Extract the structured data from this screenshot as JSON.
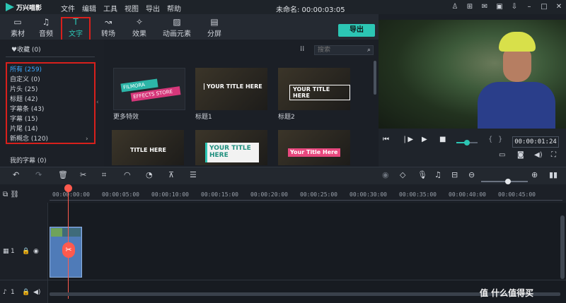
{
  "app": {
    "logo_text": "万兴喵影",
    "window_title": "未命名: 00:00:03:05",
    "menus": [
      "文件",
      "编辑",
      "工具",
      "视图",
      "导出",
      "帮助"
    ]
  },
  "tabs": [
    {
      "label": "素材",
      "icon": "folder-icon"
    },
    {
      "label": "音频",
      "icon": "music-note-icon"
    },
    {
      "label": "文字",
      "icon": "text-icon",
      "active": true
    },
    {
      "label": "转场",
      "icon": "transition-icon"
    },
    {
      "label": "效果",
      "icon": "effects-icon"
    },
    {
      "label": "动画元素",
      "icon": "image-icon"
    },
    {
      "label": "分屏",
      "icon": "split-screen-icon"
    }
  ],
  "export_label": "导出",
  "sidebar": {
    "favorites": "♥收藏 (0)",
    "categories": [
      {
        "label": "所有 (259)",
        "selected": true
      },
      {
        "label": "自定义 (0)"
      },
      {
        "label": "片头 (25)"
      },
      {
        "label": "标题 (42)"
      },
      {
        "label": "字幕条 (43)"
      },
      {
        "label": "字幕 (15)"
      },
      {
        "label": "片尾 (14)"
      },
      {
        "label": "新概念 (120)"
      }
    ],
    "my_subtitles": "我的字幕 (0)"
  },
  "search": {
    "placeholder": "搜索"
  },
  "thumbnails": [
    {
      "label": "更多特效",
      "line1": "FILMORA",
      "line2": "EFFECTS STORE"
    },
    {
      "label": "标题1",
      "text": "YOUR TITLE HERE"
    },
    {
      "label": "标题2",
      "text": "YOUR TITLE HERE"
    },
    {
      "label": "",
      "text": "TITLE HERE"
    },
    {
      "label": "",
      "text": "YOUR TITLE HERE"
    },
    {
      "label": "",
      "text": "Your Title Here"
    }
  ],
  "player": {
    "timecode": "00:00:01:24",
    "volume": 0.45
  },
  "timeline": {
    "ticks": [
      "00:00:00:00",
      "00:00:05:00",
      "00:00:10:00",
      "00:00:15:00",
      "00:00:20:00",
      "00:00:25:00",
      "00:00:30:00",
      "00:00:35:00",
      "00:00:40:00",
      "00:00:45:00"
    ],
    "video_track": "1",
    "audio_track": "1"
  },
  "watermark": "值 什么值得买",
  "colors": {
    "accent": "#2cc6b4",
    "highlight_box": "#d8201c",
    "playhead": "#ff5a4e",
    "selected_category": "#3ea8ff"
  }
}
